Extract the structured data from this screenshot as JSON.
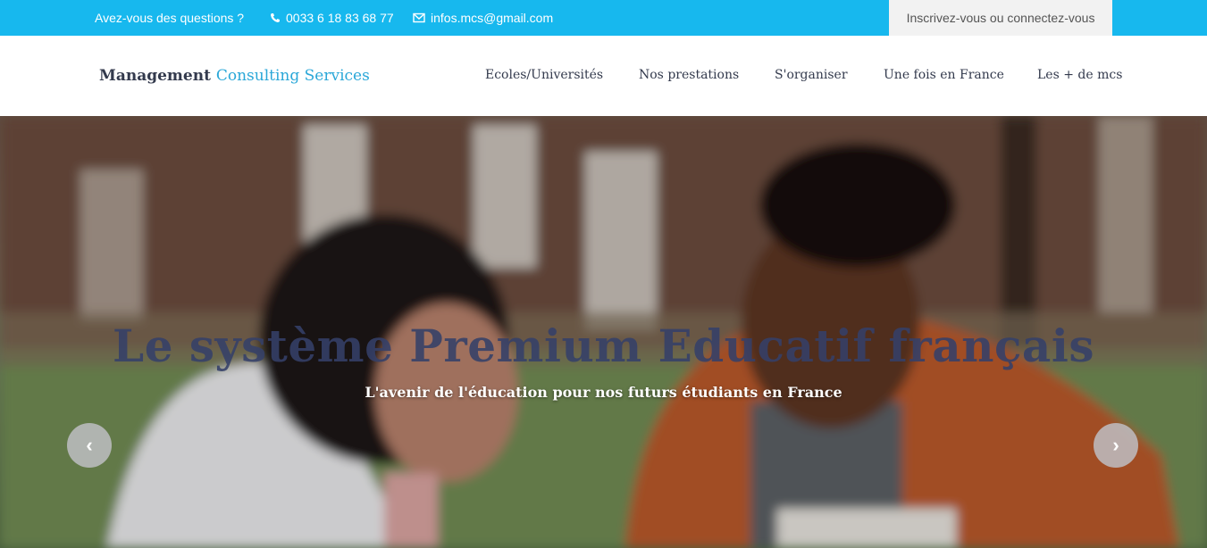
{
  "topbar": {
    "question": "Avez-vous des questions ?",
    "phone": "0033 6 18 83 68 77",
    "email": "infos.mcs@gmail.com",
    "login": "Inscrivez-vous ou connectez-vous"
  },
  "brand": {
    "part1": "Management",
    "part2": "Consulting Services"
  },
  "nav": [
    "Ecoles/Universités",
    "Nos prestations",
    "S'organiser",
    "Une fois en France",
    "Les + de mcs"
  ],
  "hero": {
    "title": "Le système Premium Educatif français",
    "subtitle": "L'avenir de l'éducation pour nos futurs étudiants en France",
    "prev": "‹",
    "next": "›"
  },
  "colors": {
    "topbar": "#17b8ee",
    "brand_accent": "#2aa7d8",
    "text": "#333a4d"
  }
}
